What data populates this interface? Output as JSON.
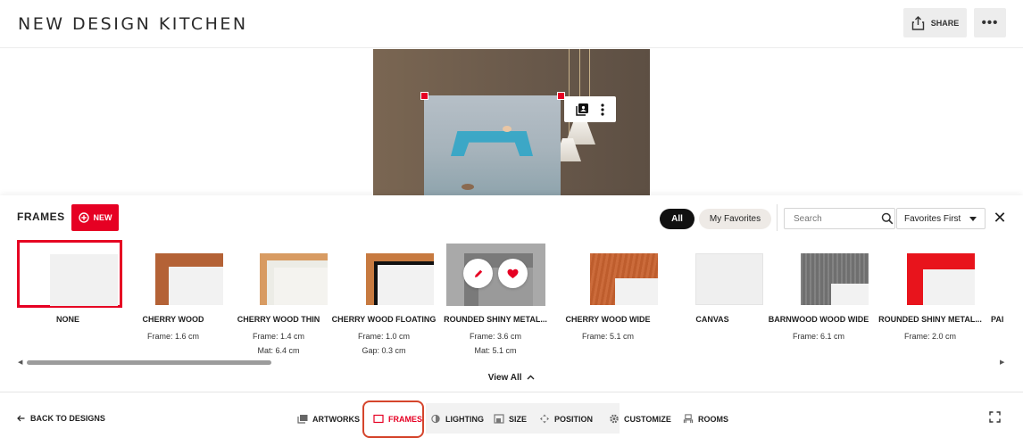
{
  "header": {
    "title": "NEW DESIGN KITCHEN",
    "share_label": "SHARE",
    "more_label": "•••"
  },
  "frames_panel": {
    "title": "FRAMES",
    "new_label": "NEW",
    "filters": {
      "all": "All",
      "favorites": "My Favorites"
    },
    "search": {
      "placeholder": "Search"
    },
    "sort": {
      "selected": "Favorites First"
    },
    "close": "✕",
    "items": [
      {
        "name": "NONE"
      },
      {
        "name": "CHERRY WOOD",
        "line1": "Frame: 1.6 cm"
      },
      {
        "name": "CHERRY WOOD THIN",
        "line1": "Frame: 1.4 cm",
        "line2": "Mat: 6.4 cm"
      },
      {
        "name": "CHERRY WOOD FLOATING",
        "line1": "Frame: 1.0 cm",
        "line2": "Gap: 0.3 cm"
      },
      {
        "name": "ROUNDED SHINY METAL...",
        "line1": "Frame: 3.6 cm",
        "line2": "Mat: 5.1 cm"
      },
      {
        "name": "CHERRY WOOD WIDE",
        "line1": "Frame: 5.1 cm"
      },
      {
        "name": "CANVAS"
      },
      {
        "name": "BARNWOOD WOOD WIDE",
        "line1": "Frame: 6.1 cm"
      },
      {
        "name": "ROUNDED SHINY METAL...",
        "line1": "Frame: 2.0 cm"
      },
      {
        "name": "PAI"
      }
    ],
    "view_all": "View All"
  },
  "bottom_nav": {
    "back": "BACK TO DESIGNS",
    "artworks": "ARTWORKS",
    "frames": "FRAMES",
    "lighting": "LIGHTING",
    "size": "SIZE",
    "position": "POSITION",
    "customize": "CUSTOMIZE",
    "rooms": "ROOMS"
  },
  "colors": {
    "accent": "#e60023",
    "cherry_wood": "#b5653a",
    "light_wood": "#d9a06a",
    "metal_red": "#e8141c"
  },
  "icons": [
    "share-icon",
    "more-icon",
    "plus-circle-icon",
    "search-icon",
    "close-icon",
    "pencil-icon",
    "heart-icon",
    "chevron-up-icon",
    "arrow-left-icon",
    "expand-icon"
  ]
}
